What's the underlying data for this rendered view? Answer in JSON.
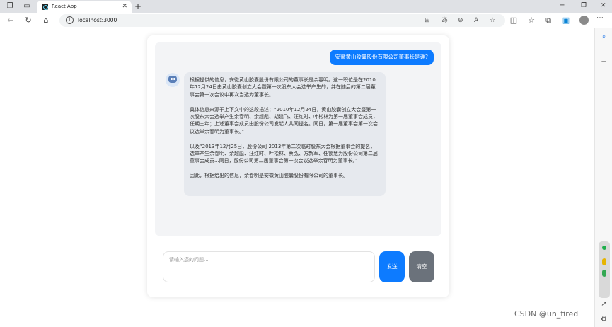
{
  "browser": {
    "tab": {
      "title": "React App"
    },
    "url": "localhost:3000"
  },
  "chat": {
    "user_message": "安徽黄山胶囊股份有限公司董事长是谁?",
    "bot_paragraphs": [
      "根据提供的信息，安徽黄山胶囊股份有限公司的董事长是余春明。这一职位是在2010年12月24日由黄山胶囊创立大会暨第一次股东大会选举产生的，并在随后的第二届董事会第一次会议中再次当选为董事长。",
      "具体信息来源于上下文中的这段描述：“2010年12月24日，黄山胶囊创立大会暨第一次股东大会选举产生余春明、余超彪、胡建飞、汪红时、叶松林为第一届董事会成员，任期三年；上述董事会成员由股份公司发起人共同提名。同日，第一届董事会第一次会议选举余春明为董事长。”",
      "以及“2013年12月25日，股份公司 2013年第二次临时股东大会根据董事会的提名，选举产生余春明、余超彪、汪红时、叶松林、蔡弘、方新军、任锁慧为股份公司第二届董事会成员...同日，股份公司第二届董事会第一次会议选举余春明为董事长。”",
      "因此，根据给出的信息，余春明是安徽黄山胶囊股份有限公司的董事长。"
    ]
  },
  "input": {
    "placeholder": "请输入您的问题..."
  },
  "buttons": {
    "send": "发送",
    "clear": "清空"
  },
  "watermark": "CSDN @un_fired",
  "colors": {
    "primary": "#0d7bff",
    "secondary": "#6b727b",
    "chat_bg": "#f3f4f6",
    "bot_bubble": "#e6e9ee"
  }
}
